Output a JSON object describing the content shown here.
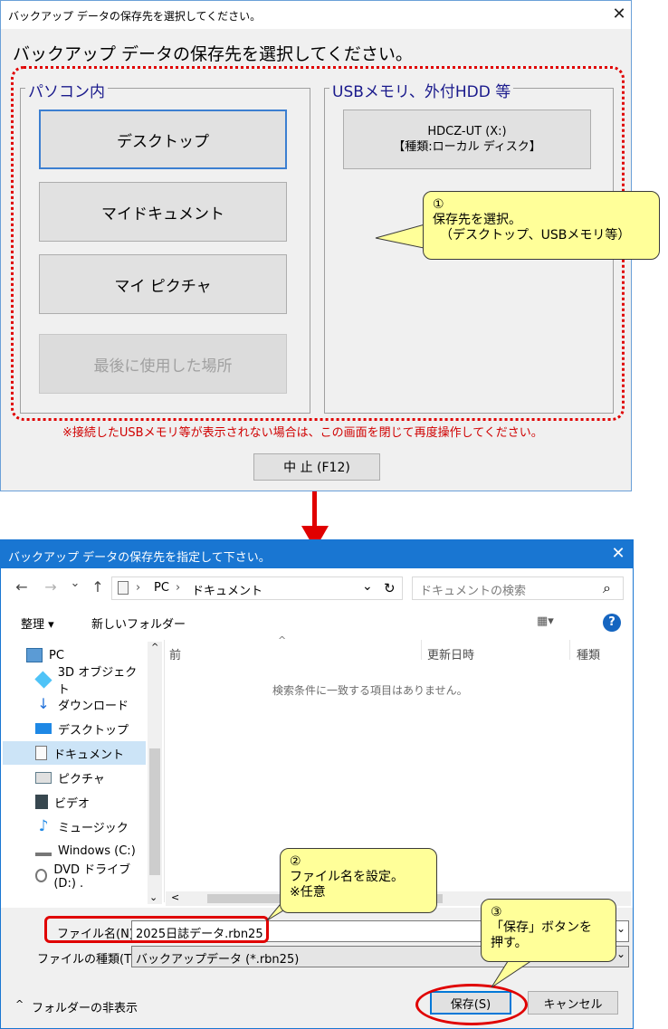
{
  "dialog1": {
    "title": "バックアップ データの保存先を選択してください。",
    "close_glyph": "✕",
    "heading": "バックアップ データの保存先を選択してください。",
    "group_pc": {
      "title": "パソコン内",
      "buttons": [
        "デスクトップ",
        "マイドキュメント",
        "マイ ピクチャ",
        "最後に使用した場所"
      ]
    },
    "group_usb": {
      "title": "USBメモリ、外付HDD 等",
      "drive_line1": "HDCZ-UT (X:)",
      "drive_line2": "【種類:ローカル ディスク】"
    },
    "notice": "※接続したUSBメモリ等が表示されない場合は、この画面を閉じて再度操作してください。",
    "cancel_button": "中 止 (F12)",
    "callout1": {
      "num": "①",
      "line1": "保存先を選択。",
      "line2": "（デスクトップ、USBメモリ等）"
    }
  },
  "arrow_color": "#e00000",
  "dialog2": {
    "title": "バックアップ データの保存先を指定して下さい。",
    "close_glyph": "✕",
    "nav": {
      "back": "←",
      "forward": "→",
      "dropdown": "⌄",
      "up": "↑"
    },
    "address": {
      "pc": "PC",
      "sep": "›",
      "folder": "ドキュメント",
      "dropdown": "⌄",
      "refresh": "↻"
    },
    "search_placeholder": "ドキュメントの検索",
    "search_icon": "⌕",
    "toolbar": {
      "organize": "整理 ▾",
      "new_folder": "新しいフォルダー",
      "view_glyph": "▦▾",
      "help_glyph": "?"
    },
    "tree": [
      {
        "label": "PC",
        "icon": "pc-icon"
      },
      {
        "label": "3D オブジェクト",
        "icon": "3d-objects-icon"
      },
      {
        "label": "ダウンロード",
        "icon": "download-icon"
      },
      {
        "label": "デスクトップ",
        "icon": "desktop-icon"
      },
      {
        "label": "ドキュメント",
        "icon": "documents-icon"
      },
      {
        "label": "ピクチャ",
        "icon": "pictures-icon"
      },
      {
        "label": "ビデオ",
        "icon": "videos-icon"
      },
      {
        "label": "ミュージック",
        "icon": "music-icon"
      },
      {
        "label": "Windows (C:)",
        "icon": "drive-icon"
      },
      {
        "label": "DVD ドライブ (D:) .",
        "icon": "dvd-icon"
      }
    ],
    "columns": {
      "name": "前",
      "date": "更新日時",
      "type": "種類"
    },
    "empty_message": "検索条件に一致する項目はありません。",
    "filename_label": "ファイル名(N):",
    "filename_value": "2025日誌データ.rbn25",
    "filetype_label": "ファイルの種類(T):",
    "filetype_value": "バックアップデータ (*.rbn25)",
    "hide_folders": "フォルダーの非表示",
    "hide_folders_glyph": "^",
    "save_button": "保存(S)",
    "cancel_button": "キャンセル",
    "callout2": {
      "num": "②",
      "line1": "ファイル名を設定。",
      "line2": "※任意"
    },
    "callout3": {
      "num": "③",
      "line1": "「保存」ボタンを",
      "line2": "押す。"
    }
  },
  "colors": {
    "annotation_red": "#e00000",
    "callout_yellow": "#ffff99",
    "titlebar_blue": "#1976d2"
  }
}
